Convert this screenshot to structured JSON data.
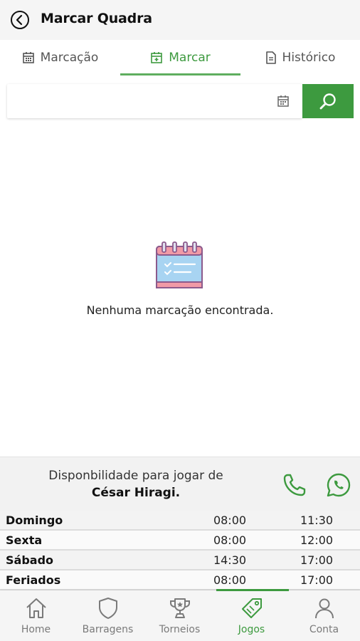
{
  "appbar": {
    "title": "Marcar Quadra",
    "back_icon": "back-arrow-circle-icon"
  },
  "tabs": [
    {
      "label": "Marcação",
      "icon": "calendar-grid-icon",
      "active": false
    },
    {
      "label": "Marcar",
      "icon": "calendar-add-icon",
      "active": true
    },
    {
      "label": "Histórico",
      "icon": "document-icon",
      "active": false
    }
  ],
  "search": {
    "value": "",
    "placeholder": "",
    "calendar_icon": "calendar-icon",
    "button_icon": "search-icon"
  },
  "empty_state": {
    "icon": "calendar-checklist-icon",
    "message": "Nenhuma marcação encontrada."
  },
  "availability": {
    "label": "Disponbilidade para jogar de",
    "name": "César Hiragi.",
    "phone_icon": "phone-icon",
    "whatsapp_icon": "whatsapp-icon"
  },
  "schedule": [
    {
      "day": "Domingo",
      "from": "08:00",
      "to": "11:30"
    },
    {
      "day": "Sexta",
      "from": "08:00",
      "to": "12:00"
    },
    {
      "day": "Sábado",
      "from": "14:30",
      "to": "17:00"
    },
    {
      "day": "Feriados",
      "from": "08:00",
      "to": "17:00"
    }
  ],
  "bottom_nav": [
    {
      "label": "Home",
      "icon": "home-icon",
      "active": false
    },
    {
      "label": "Barragens",
      "icon": "shield-icon",
      "active": false
    },
    {
      "label": "Torneios",
      "icon": "trophy-icon",
      "active": false
    },
    {
      "label": "Jogos",
      "icon": "tag-icon",
      "active": true
    },
    {
      "label": "Conta",
      "icon": "user-icon",
      "active": false
    }
  ],
  "colors": {
    "accent": "#3d9a3f",
    "appbar_bg": "#f5f5f5",
    "inactive": "#7a7a7a"
  }
}
